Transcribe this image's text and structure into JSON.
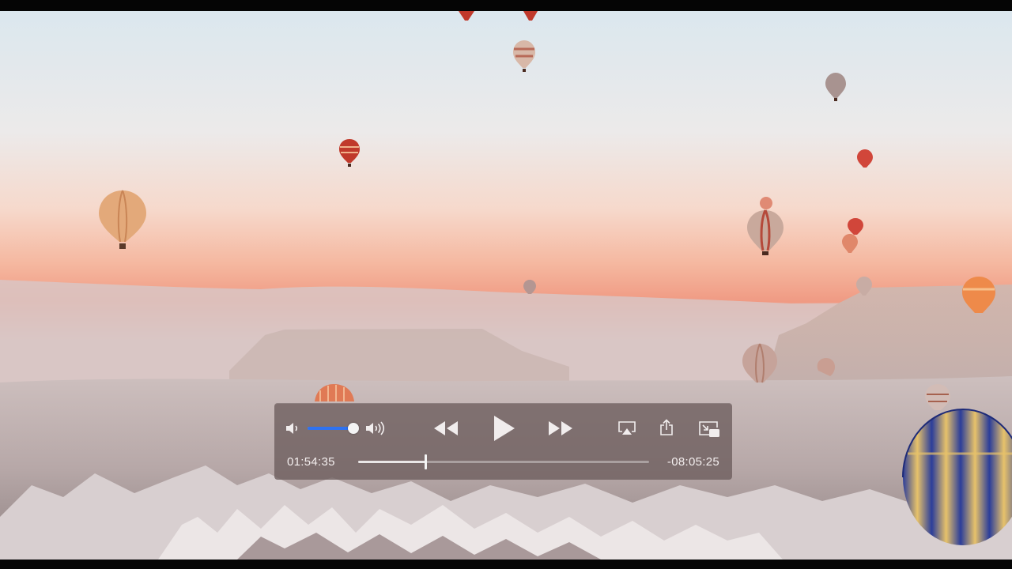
{
  "player": {
    "elapsed_time": "01:54:35",
    "remaining_time": "-08:05:25",
    "playback_progress": 0.23,
    "volume_level": 1.0,
    "state": "paused",
    "accent_color": "#2f72f0"
  },
  "controls": {
    "icons": [
      "volume-low-icon",
      "volume-high-icon",
      "rewind-icon",
      "play-icon",
      "fast-forward-icon",
      "airplay-icon",
      "share-icon",
      "picture-in-picture-icon"
    ]
  }
}
